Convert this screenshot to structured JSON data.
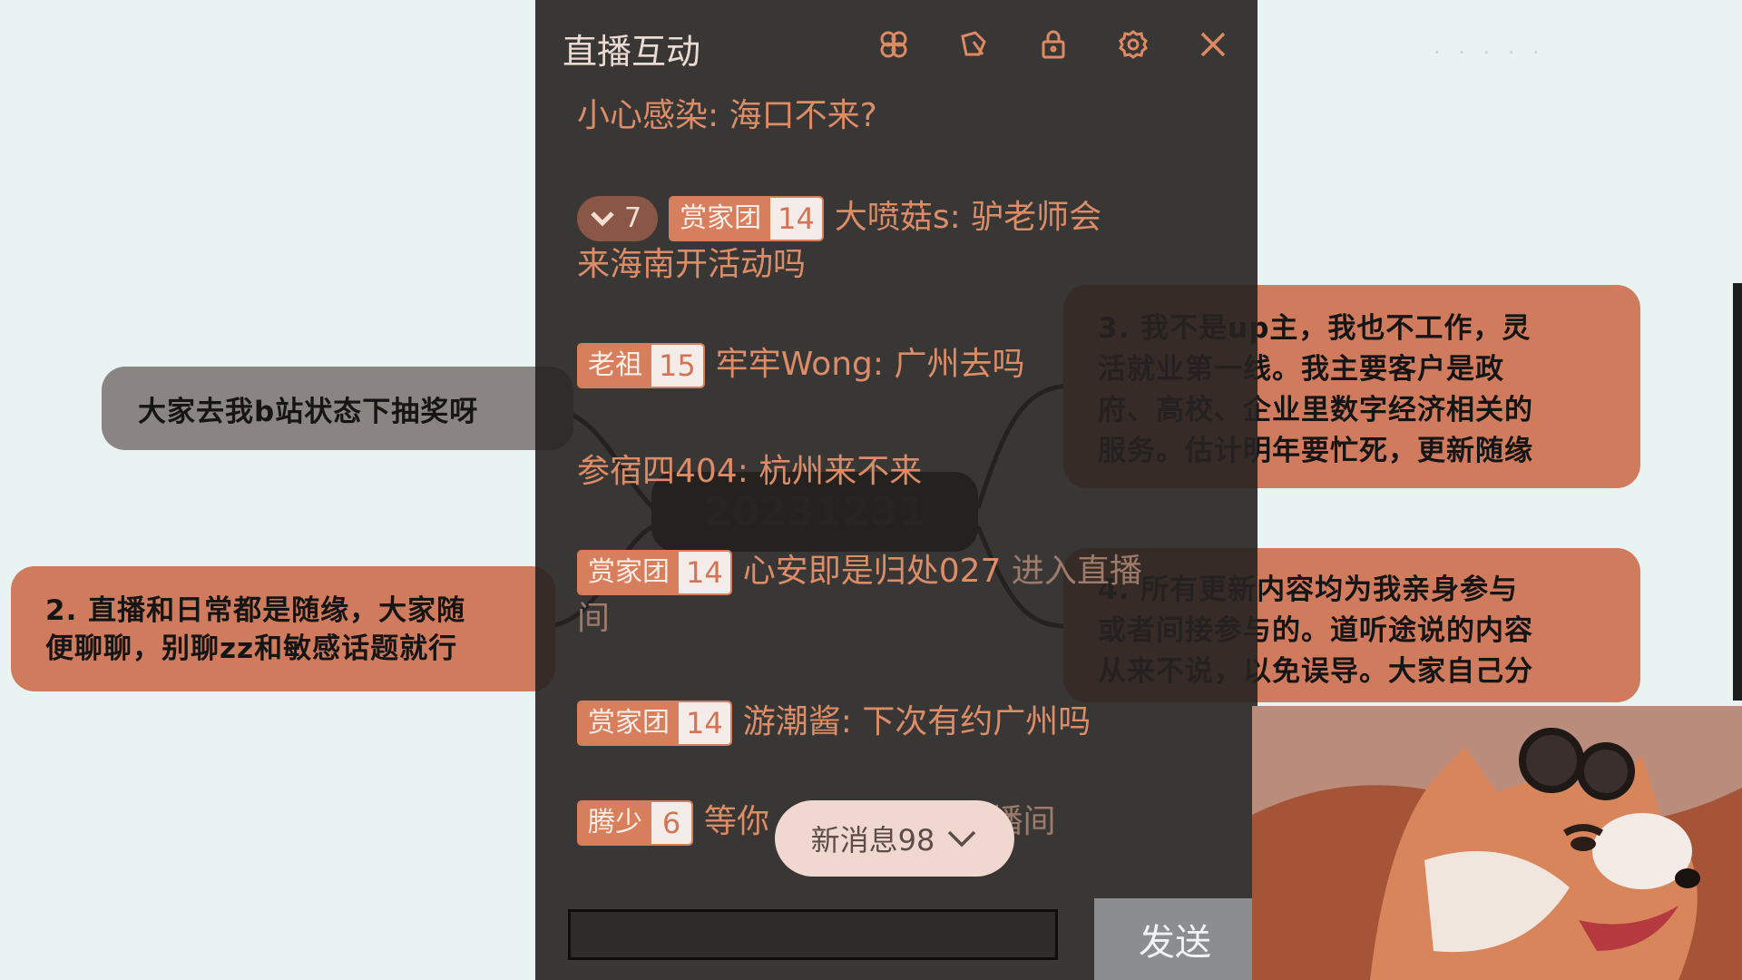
{
  "background": {
    "node_left_top": "大家去我b站状态下抽奖呀",
    "node_left_mid": [
      "2. 直播和日常都是随缘，大家随",
      "便聊聊，别聊zz和敏感话题就行"
    ],
    "node_right_top": [
      "3. 我不是up主，我也不工作，灵",
      "活就业第一线。我主要客户是政",
      "府、高校、企业里数字经济相关的",
      "服务。估计明年要忙死，更新随缘"
    ],
    "node_right_mid": [
      "4. 所有更新内容均为我亲身参与",
      "或者间接参与的。道听途说的内容",
      "从来不说，以免误导。大家自己分"
    ],
    "center_node": "20231231",
    "faint_text": "· · · · ·"
  },
  "panel": {
    "title": "直播互动",
    "icons": [
      "lottery-icon",
      "clear-icon",
      "lock-icon",
      "gear-icon",
      "close-icon"
    ]
  },
  "messages": {
    "m1": {
      "text": "小心感染: 海口不来?"
    },
    "m2": {
      "vip_level": "7",
      "badge": "赏家团",
      "badge_level": "14",
      "line1": "大喷菇s: 驴老师会",
      "line2": "来海南开活动吗"
    },
    "m3": {
      "badge": "老祖",
      "badge_level": "15",
      "text": "牢牢Wong: 广州去吗"
    },
    "m4": {
      "text": "参宿四404: 杭州来不来"
    },
    "m5": {
      "badge": "赏家团",
      "badge_level": "14",
      "text": "心安即是归处027",
      "suffix": "进入直播",
      "suffix2": "间"
    },
    "m6": {
      "badge": "赏家团",
      "badge_level": "14",
      "text": "游潮酱: 下次有约广州吗"
    },
    "m7": {
      "badge": "腾少",
      "badge_level": "6",
      "text": "等你",
      "suffix": "直播间"
    }
  },
  "new_messages": {
    "label": "新消息98"
  },
  "input": {
    "value": "",
    "placeholder": ""
  },
  "send_button": "发送",
  "colors": {
    "accent": "#d77e5c",
    "panel_bg": "#262221",
    "node_orange": "#d07b5e",
    "node_gray": "#8a8582"
  }
}
